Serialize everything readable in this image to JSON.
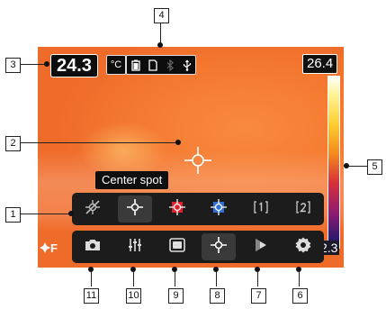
{
  "screen": {
    "spot_temperature": "24.3",
    "unit": "°C",
    "scale_max": "26.4",
    "scale_min": "2.3",
    "tooltip": "Center spot",
    "logo": "F"
  },
  "status_icons": [
    "battery-icon",
    "sd-card-icon",
    "bluetooth-icon",
    "usb-icon"
  ],
  "tool_buttons": [
    {
      "name": "no-measurement-button",
      "icon": "crossed-crosshair-icon"
    },
    {
      "name": "center-spot-button",
      "icon": "center-spot-icon",
      "active": true
    },
    {
      "name": "hot-spot-button",
      "icon": "hot-spot-icon"
    },
    {
      "name": "cold-spot-button",
      "icon": "cold-spot-icon"
    },
    {
      "name": "user-preset-1-button",
      "icon": "preset-1-icon"
    },
    {
      "name": "user-preset-2-button",
      "icon": "preset-2-icon"
    }
  ],
  "main_buttons": [
    {
      "name": "camera-button",
      "icon": "camera-icon"
    },
    {
      "name": "adjust-button",
      "icon": "sliders-icon"
    },
    {
      "name": "image-mode-button",
      "icon": "image-mode-icon"
    },
    {
      "name": "measurement-button",
      "icon": "crosshair-icon",
      "active": true
    },
    {
      "name": "color-palette-button",
      "icon": "palette-icon"
    },
    {
      "name": "settings-button",
      "icon": "gear-icon"
    }
  ],
  "callouts": {
    "c1": "1",
    "c2": "2",
    "c3": "3",
    "c4": "4",
    "c5": "5",
    "c6": "6",
    "c7": "7",
    "c8": "8",
    "c9": "9",
    "c10": "10",
    "c11": "11"
  },
  "colors": {
    "hot_spot": "#e2202a",
    "cold_spot": "#2f6fd8",
    "toolbar_bg": "#1c1c1c"
  }
}
